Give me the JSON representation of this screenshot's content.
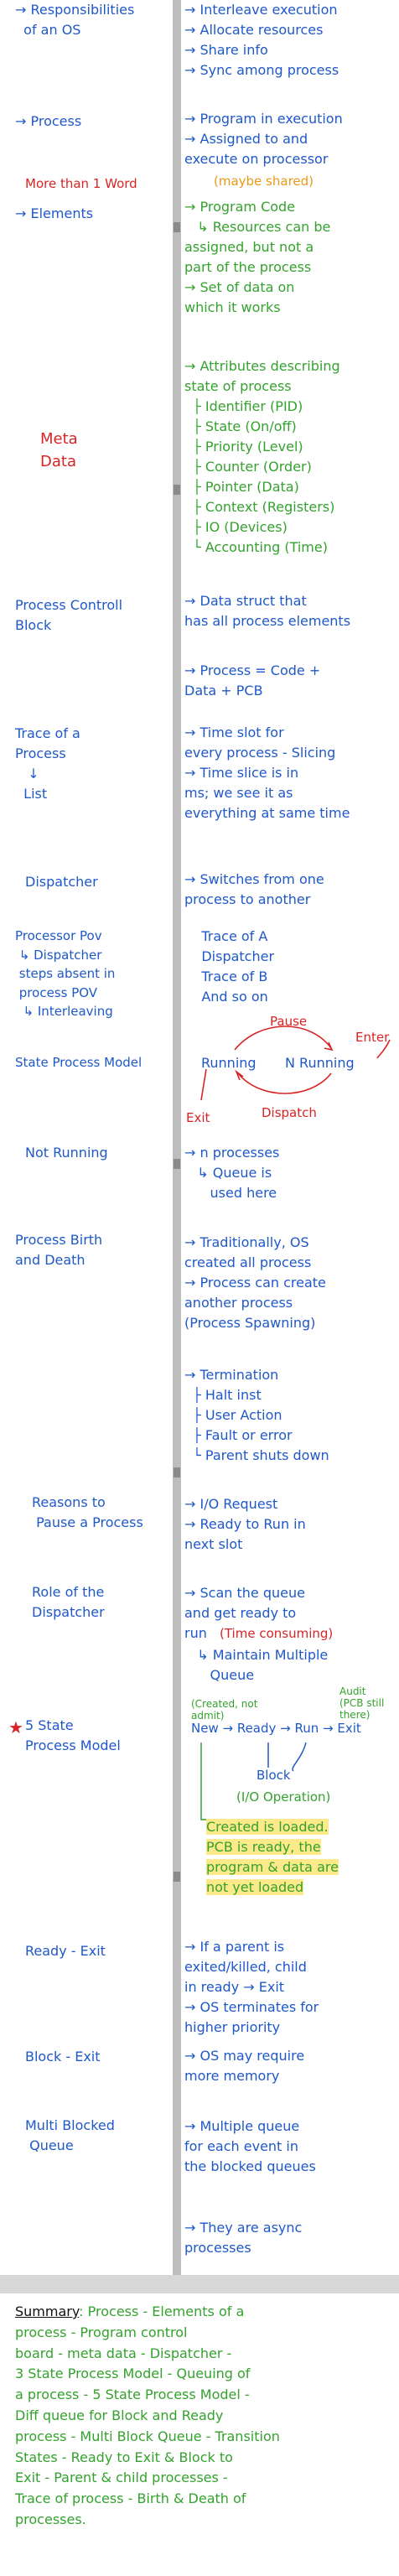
{
  "left_notes": [
    {
      "text": "→ Responsibilities\n  of an OS",
      "class": "blue"
    },
    {
      "text": "→ Process",
      "class": "blue"
    },
    {
      "text": "More than 1 Word",
      "class": "red"
    },
    {
      "text": "→ Elements",
      "class": "blue"
    },
    {
      "text": "Meta\nData",
      "class": "red"
    },
    {
      "text": "Process Controll\nBlock",
      "class": "blue"
    },
    {
      "text": "Trace of a\nProcess\n   ↓\n  List",
      "class": "blue"
    },
    {
      "text": "Dispatcher",
      "class": "blue"
    },
    {
      "text": "Processor Pov\n ↳ Dispatcher\n steps absent in\n process POV\n  ↳ Interleaving",
      "class": "blue"
    },
    {
      "text": "State Process Model",
      "class": "blue"
    },
    {
      "text": "Not Running",
      "class": "blue"
    },
    {
      "text": "Process Birth\nand Death",
      "class": "blue"
    },
    {
      "text": "Reasons to\n Pause a Process",
      "class": "blue"
    },
    {
      "text": "Role of the\nDispatcher",
      "class": "blue"
    },
    {
      "text": "5 State\nProcess Model",
      "class": "blue"
    },
    {
      "text": "Ready - Exit",
      "class": "blue"
    },
    {
      "text": "Block - Exit",
      "class": "blue"
    },
    {
      "text": "Multi Blocked\n Queue",
      "class": "blue"
    }
  ],
  "right_notes": [
    {
      "text": "→ Interleave execution\n→ Allocate resources\n→ Share info\n→ Sync among process",
      "class": "blue"
    },
    {
      "text": "→ Program in execution\n→ Assigned to and\nexecute on processor",
      "class": "blue"
    },
    {
      "text": "(maybe shared)",
      "class": "orange"
    },
    {
      "text": "→ Program Code\n   ↳ Resources can be\nassigned, but not a\npart of the process\n→ Set of data on\nwhich it works",
      "class": "green"
    },
    {
      "text": "→ Attributes describing\nstate of process\n  ├ Identifier (PID)\n  ├ State (On/off)\n  ├ Priority (Level)\n  ├ Counter (Order)\n  ├ Pointer (Data)\n  ├ Context (Registers)\n  ├ IO (Devices)\n  └ Accounting (Time)",
      "class": "green"
    },
    {
      "text": "→ Data struct that\nhas all process elements",
      "class": "blue"
    },
    {
      "text": "→ Process = Code +\nData + PCB",
      "class": "blue"
    },
    {
      "text": "→ Time slot for\nevery process - Slicing\n→ Time slice is in\nms; we see it as\neverything at same time",
      "class": "blue"
    },
    {
      "text": "→ Switches from one\nprocess to another",
      "class": "blue"
    },
    {
      "text": "    Trace of A\n    Dispatcher\n    Trace of B\n    And so on",
      "class": "blue"
    },
    {
      "text": "→ n processes\n   ↳ Queue is\n      used here",
      "class": "blue"
    },
    {
      "text": "→ Traditionally, OS\ncreated all process\n→ Process can create\nanother process\n(Process Spawning)",
      "class": "blue"
    },
    {
      "text": "→ Termination\n  ├ Halt inst\n  ├ User Action\n  ├ Fault or error\n  └ Parent shuts down",
      "class": "blue"
    },
    {
      "text": "→ I/O Request\n→ Ready to Run in\nnext slot",
      "class": "blue"
    },
    {
      "text": "→ Scan the queue\nand get ready to\nrun",
      "class": "blue"
    },
    {
      "text": "(Time consuming)",
      "class": "red"
    },
    {
      "text": "   ↳ Maintain Multiple\n      Queue",
      "class": "blue"
    },
    {
      "text": "→ If a parent is\nexited/killed, child\nin ready → Exit\n→ OS terminates for\nhigher priority",
      "class": "blue"
    },
    {
      "text": "→ OS may require\nmore memory",
      "class": "blue"
    },
    {
      "text": "→ Multiple queue\nfor each event in\nthe blocked queues",
      "class": "blue"
    },
    {
      "text": "→ They are async\nprocesses",
      "class": "blue"
    }
  ],
  "state_diagram": {
    "pause": "Pause",
    "enter": "Enter",
    "running": "Running",
    "not_running": "N Running",
    "exit": "Exit",
    "dispatch": "Dispatch"
  },
  "five_state": {
    "created_note": "(Created, not admit)",
    "audit_note": "Audit\n(PCB still there)",
    "line": "New → Ready → Run → Exit",
    "block": "Block",
    "io_note": "(I/O Operation)",
    "highlight": "Created is loaded.\nPCB is ready, the\nprogram & data are\nnot yet loaded"
  },
  "summary": {
    "title": "Summary",
    "body": ": Process - Elements of a\nprocess - Program control\nboard - meta data - Dispatcher -\n3 State Process Model - Queuing of\na process - 5 State Process Model -\nDiff queue for Block and Ready\nprocess - Multi Block Queue - Transition\nStates - Ready to Exit & Block to\nExit - Parent & child processes -\nTrace of process - Birth & Death of\nprocesses."
  }
}
